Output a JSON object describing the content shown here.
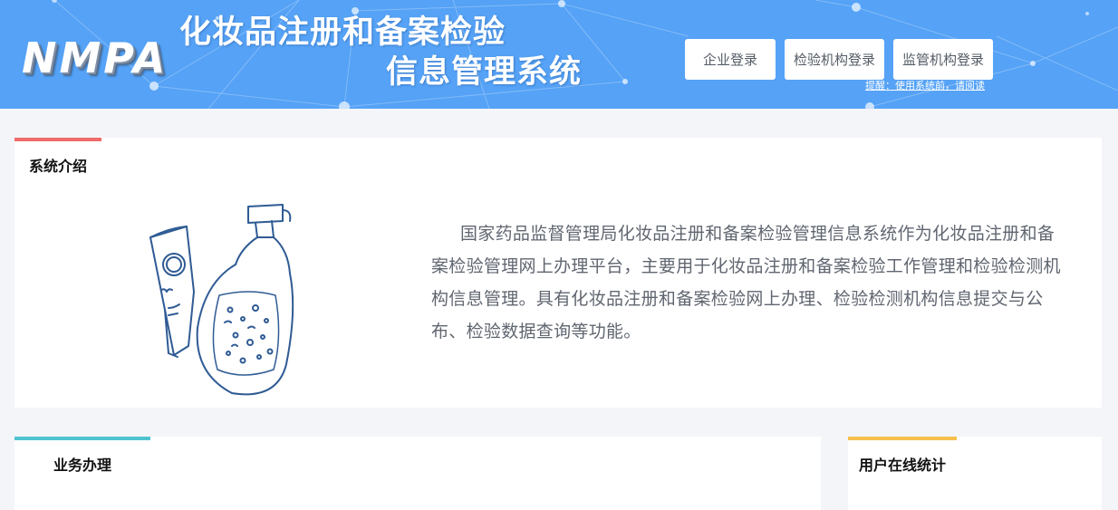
{
  "header": {
    "logo_text": "NMPA",
    "title_line1": "化妆品注册和备案检验",
    "title_line2": "信息管理系统",
    "background_color": "#55a2f6",
    "login_buttons": [
      "企业登录",
      "检验机构登录",
      "监管机构登录"
    ],
    "reminder": "提醒：使用系统前，请阅读"
  },
  "intro": {
    "title": "系统介绍",
    "accent_color": "#f06b6b",
    "illustration_icon": "cosmetics-bottle-icon",
    "text": "国家药品监督管理局化妆品注册和备案检验管理信息系统作为化妆品注册和备案检验管理网上办理平台，主要用于化妆品注册和备案检验工作管理和检验检测机构信息管理。具有化妆品注册和备案检验网上办理、检验检测机构信息提交与公布、检验数据查询等功能。"
  },
  "business": {
    "title": "业务办理",
    "accent_color": "#4ec3cf"
  },
  "stats": {
    "title": "用户在线统计",
    "accent_color": "#f5c04c"
  }
}
